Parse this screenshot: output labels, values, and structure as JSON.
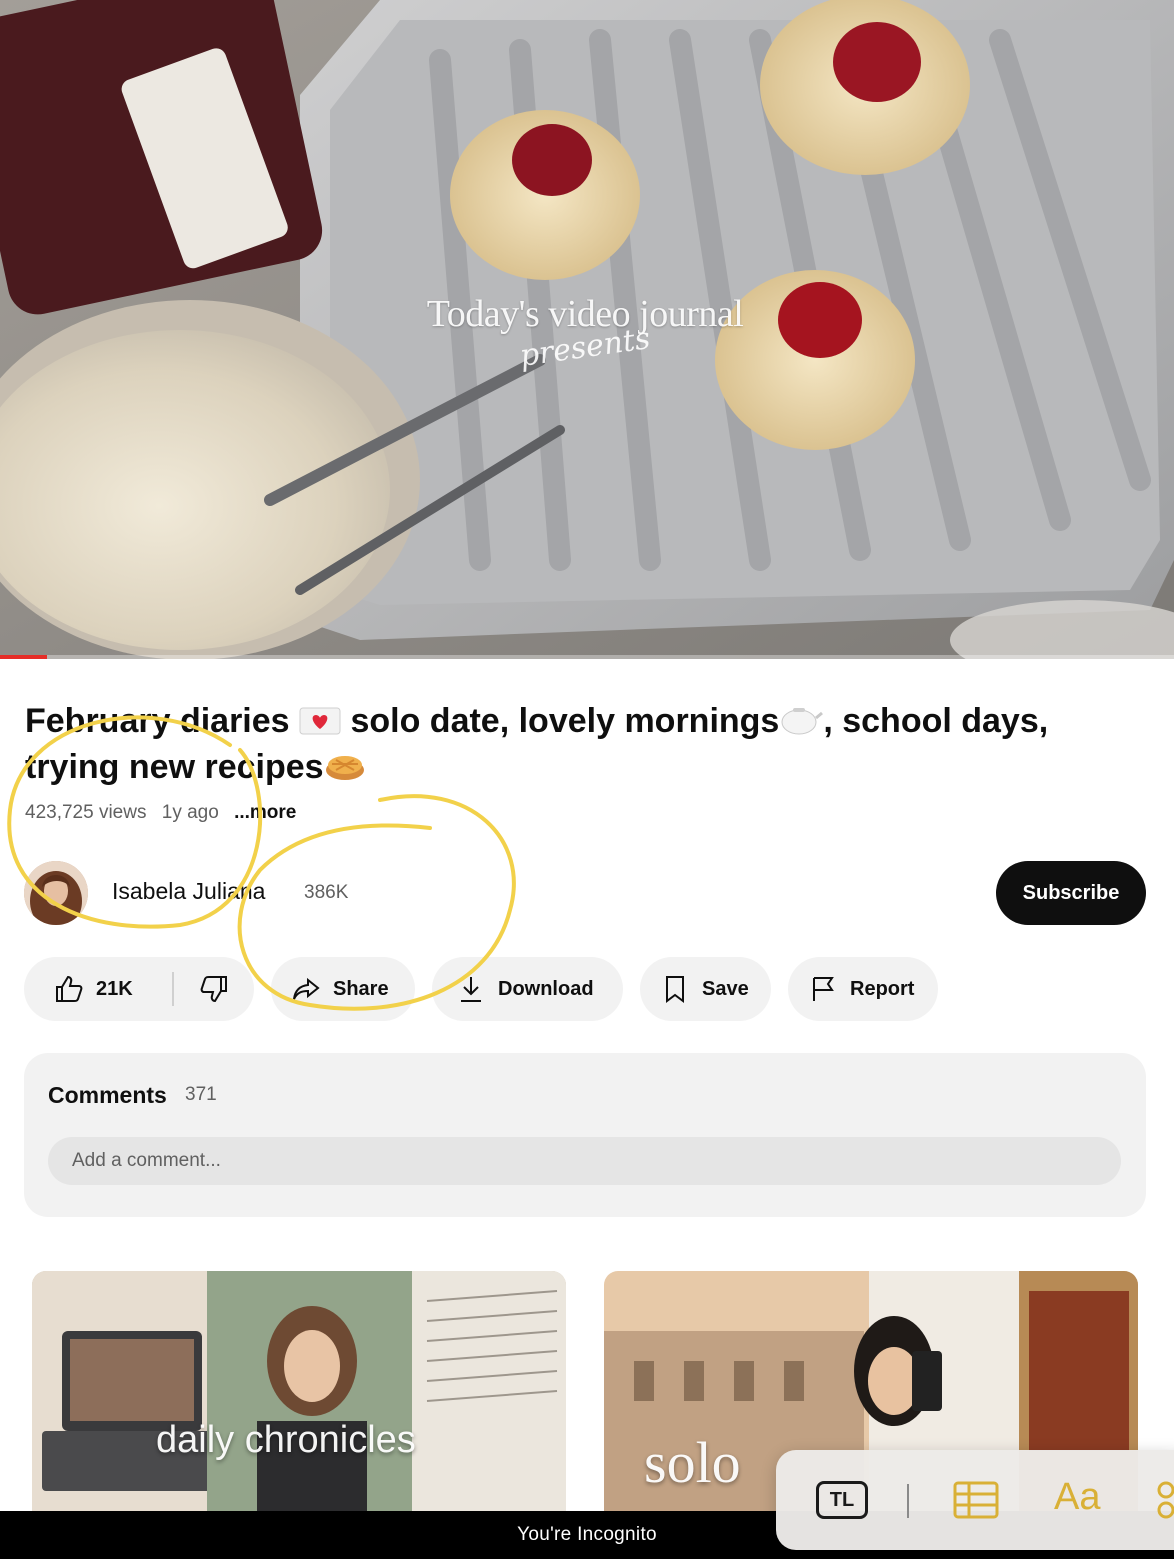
{
  "video": {
    "overlay_title": "Today's video journal",
    "overlay_subtitle": "presents",
    "progress_fraction": 0.04
  },
  "title": {
    "part1": "February diaries",
    "part2": "solo date, lovely mornings",
    "part3": ", school days, trying new recipes"
  },
  "meta": {
    "views": "423,725 views",
    "age": "1y ago",
    "more": "...more"
  },
  "channel": {
    "name": "Isabela Juliana",
    "subscribers": "386K",
    "subscribe_label": "Subscribe"
  },
  "actions": {
    "likes": "21K",
    "share": "Share",
    "download": "Download",
    "save": "Save",
    "report": "Report"
  },
  "comments": {
    "title": "Comments",
    "count": "371",
    "placeholder": "Add a comment..."
  },
  "recommendations": [
    {
      "thumb_text": "daily chronicles"
    },
    {
      "thumb_text": "solo"
    }
  ],
  "incognito": {
    "label": "You're Incognito"
  },
  "toolbar": {
    "tl_label": "TL",
    "aa_label": "Aa"
  },
  "colors": {
    "accent_red": "#e52d27",
    "subscribe_bg": "#0f0f0f",
    "pill_bg": "#f2f2f2",
    "annotation_yellow": "#f2d14a",
    "toolbar_gold": "#d9b036"
  }
}
